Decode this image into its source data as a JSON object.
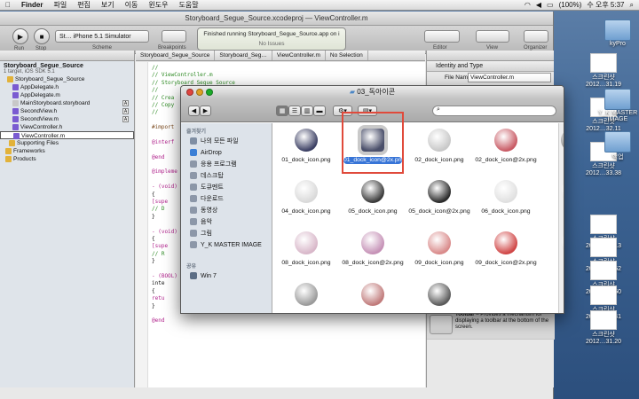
{
  "menubar": {
    "items": [
      "Finder",
      "파일",
      "편집",
      "보기",
      "이동",
      "윈도우",
      "도움말"
    ],
    "battery": "(100%)",
    "clock": "수 오후 5:37"
  },
  "xcode": {
    "window_title": "Storyboard_Segue_Source.xcodeproj — ViewController.m",
    "run_label": "Run",
    "stop_label": "Stop",
    "scheme_value": "St…  iPhone 5.1 Simulator",
    "scheme_label": "Scheme",
    "breakpoints_label": "Breakpoints",
    "status_text": "Finished running Storyboard_Segue_Source.app on i",
    "status_sub": "No Issues",
    "editor_label": "Editor",
    "view_label": "View",
    "organizer_label": "Organizer"
  },
  "navigator": {
    "project_name": "Storyboard_Segue_Source",
    "project_sub": "1 target, iOS SDK 5.1",
    "items": [
      {
        "label": "Storyboard_Segue_Source",
        "badge": ""
      },
      {
        "label": "AppDelegate.h",
        "badge": ""
      },
      {
        "label": "AppDelegate.m",
        "badge": ""
      },
      {
        "label": "MainStoryboard.storyboard",
        "badge": "A"
      },
      {
        "label": "SecondView.h",
        "badge": "A"
      },
      {
        "label": "SecondView.m",
        "badge": "A"
      },
      {
        "label": "ViewController.h",
        "badge": ""
      },
      {
        "label": "ViewController.m",
        "badge": ""
      },
      {
        "label": "Supporting Files",
        "badge": ""
      },
      {
        "label": "Frameworks",
        "badge": ""
      },
      {
        "label": "Products",
        "badge": ""
      }
    ]
  },
  "jumpbar": {
    "items": [
      "Storyboard_Segue_Source",
      "Storyboard_Seg…",
      "ViewController.m",
      "No Selection"
    ]
  },
  "editor": {
    "lines": [
      {
        "text": "//",
        "kind": "cm"
      },
      {
        "text": "//  ViewController.m",
        "kind": "cm"
      },
      {
        "text": "//  Storyboard_Segue_Source",
        "kind": "cm"
      },
      {
        "text": "//",
        "kind": "cm"
      },
      {
        "text": "//  Crea",
        "kind": "cm"
      },
      {
        "text": "//  Copy",
        "kind": "cm"
      },
      {
        "text": "//",
        "kind": "cm"
      },
      {
        "text": "",
        "kind": ""
      },
      {
        "text": "#import",
        "kind": "pp"
      },
      {
        "text": "",
        "kind": ""
      },
      {
        "text": "@interf",
        "kind": "kw"
      },
      {
        "text": "",
        "kind": ""
      },
      {
        "text": "@end",
        "kind": "kw"
      },
      {
        "text": "",
        "kind": ""
      },
      {
        "text": "@impleme",
        "kind": "kw"
      },
      {
        "text": "",
        "kind": ""
      },
      {
        "text": "- (void)",
        "kind": "kw"
      },
      {
        "text": "{",
        "kind": ""
      },
      {
        "text": "    [supe",
        "kind": "kw"
      },
      {
        "text": "    // D",
        "kind": "cm"
      },
      {
        "text": "}",
        "kind": ""
      },
      {
        "text": "",
        "kind": ""
      },
      {
        "text": "- (void)",
        "kind": "kw"
      },
      {
        "text": "{",
        "kind": ""
      },
      {
        "text": "    [supe",
        "kind": "kw"
      },
      {
        "text": "    // R",
        "kind": "cm"
      },
      {
        "text": "}",
        "kind": ""
      },
      {
        "text": "",
        "kind": ""
      },
      {
        "text": "- (BOOL)",
        "kind": "kw"
      },
      {
        "text": "    inte",
        "kind": ""
      },
      {
        "text": "{",
        "kind": ""
      },
      {
        "text": "    retu",
        "kind": "kw"
      },
      {
        "text": "}",
        "kind": ""
      },
      {
        "text": "",
        "kind": ""
      },
      {
        "text": "@end",
        "kind": "kw"
      }
    ]
  },
  "inspector": {
    "section_title": "Identity and Type",
    "file_name_label": "File Name",
    "file_name_value": "ViewController.m",
    "library": [
      {
        "title": "Search Bar",
        "desc": " – Displays an editable search bar, containing the search icon, that sends an action message to a…"
      },
      {
        "title": "Search Bar and Search Display Controller",
        "desc": " – Displays an editable search bar connected to a search…"
      },
      {
        "title": "Toolbar",
        "desc": " – Provides a mechanism for displaying a toolbar at the bottom of the screen."
      }
    ]
  },
  "finder": {
    "title": "03_독아이콘",
    "sidebar": {
      "favorites_heading": "즐겨찾기",
      "favorites": [
        {
          "label": "나의 모든 파일",
          "color": "#7f8ea3"
        },
        {
          "label": "AirDrop",
          "color": "#3b7fd6"
        },
        {
          "label": "응용 프로그램",
          "color": "#8c97a8"
        },
        {
          "label": "데스크탑",
          "color": "#8c97a8"
        },
        {
          "label": "도큐멘트",
          "color": "#8c97a8"
        },
        {
          "label": "다운로드",
          "color": "#8c97a8"
        },
        {
          "label": "동영상",
          "color": "#8c97a8"
        },
        {
          "label": "음악",
          "color": "#8c97a8"
        },
        {
          "label": "그림",
          "color": "#8c97a8"
        },
        {
          "label": "Y_K MASTER IMAGE",
          "color": "#8c97a8"
        }
      ],
      "shared_heading": "공유",
      "shared": [
        {
          "label": "Win 7",
          "color": "#5b6d85"
        }
      ]
    },
    "files": [
      {
        "name": "01_dock_icon.png",
        "color": "#3b3f63",
        "selected": false
      },
      {
        "name": "01_dock_icon@2x.png",
        "color": "#4a4f6a",
        "selected": true
      },
      {
        "name": "02_dock_icon.png",
        "color": "#c8c8c8",
        "selected": false
      },
      {
        "name": "02_dock_icon@2x.png",
        "color": "#c85a64",
        "selected": false
      },
      {
        "name": "03_do",
        "color": "#888888",
        "selected": false
      },
      {
        "name": "04_dock_icon.png",
        "color": "#d9d9d9",
        "selected": false
      },
      {
        "name": "05_dock_icon.png",
        "color": "#3a3a3a",
        "selected": false
      },
      {
        "name": "05_dock_icon@2x.png",
        "color": "#2a2a2a",
        "selected": false
      },
      {
        "name": "06_dock_icon.png",
        "color": "#e0e0e0",
        "selected": false
      },
      {
        "name": "06_do",
        "color": "#e6e6e6",
        "selected": false
      },
      {
        "name": "08_dock_icon.png",
        "color": "#d8b7c9",
        "selected": false
      },
      {
        "name": "08_dock_icon@2x.png",
        "color": "#c591b6",
        "selected": false
      },
      {
        "name": "09_dock_icon.png",
        "color": "#d98a8a",
        "selected": false
      },
      {
        "name": "09_dock_icon@2x.png",
        "color": "#d04646",
        "selected": false
      },
      {
        "name": "10_do",
        "color": "#e6e6e6",
        "selected": false
      },
      {
        "name": "",
        "color": "#9a9a9a",
        "selected": false
      },
      {
        "name": "",
        "color": "#c07a7a",
        "selected": false
      },
      {
        "name": "",
        "color": "#5a5a5a",
        "selected": false
      }
    ]
  },
  "desktop": {
    "icons": [
      {
        "label": "스크린샷",
        "sub": "2012…31.19",
        "kind": "shot"
      },
      {
        "label": "kyPro",
        "sub": "",
        "kind": "folder"
      },
      {
        "label": "스크린샷",
        "sub": "2012…32.11",
        "kind": "shot"
      },
      {
        "label": "Y_K MASTER IMAGE",
        "sub": "",
        "kind": "folder"
      },
      {
        "label": "스크린샷",
        "sub": "2012…33.38",
        "kind": "shot"
      },
      {
        "label": "백업",
        "sub": "",
        "kind": "folder"
      },
      {
        "label": "스크린샷",
        "sub": "2012…28.13",
        "kind": "shot"
      },
      {
        "label": "스크린샷",
        "sub": "2012…28.52",
        "kind": "shot"
      },
      {
        "label": "스크린샷",
        "sub": "2012…29.50",
        "kind": "shot"
      },
      {
        "label": "스크린샷",
        "sub": "2012…30.41",
        "kind": "shot"
      },
      {
        "label": "스크린샷",
        "sub": "2012…31.20",
        "kind": "shot"
      }
    ]
  }
}
